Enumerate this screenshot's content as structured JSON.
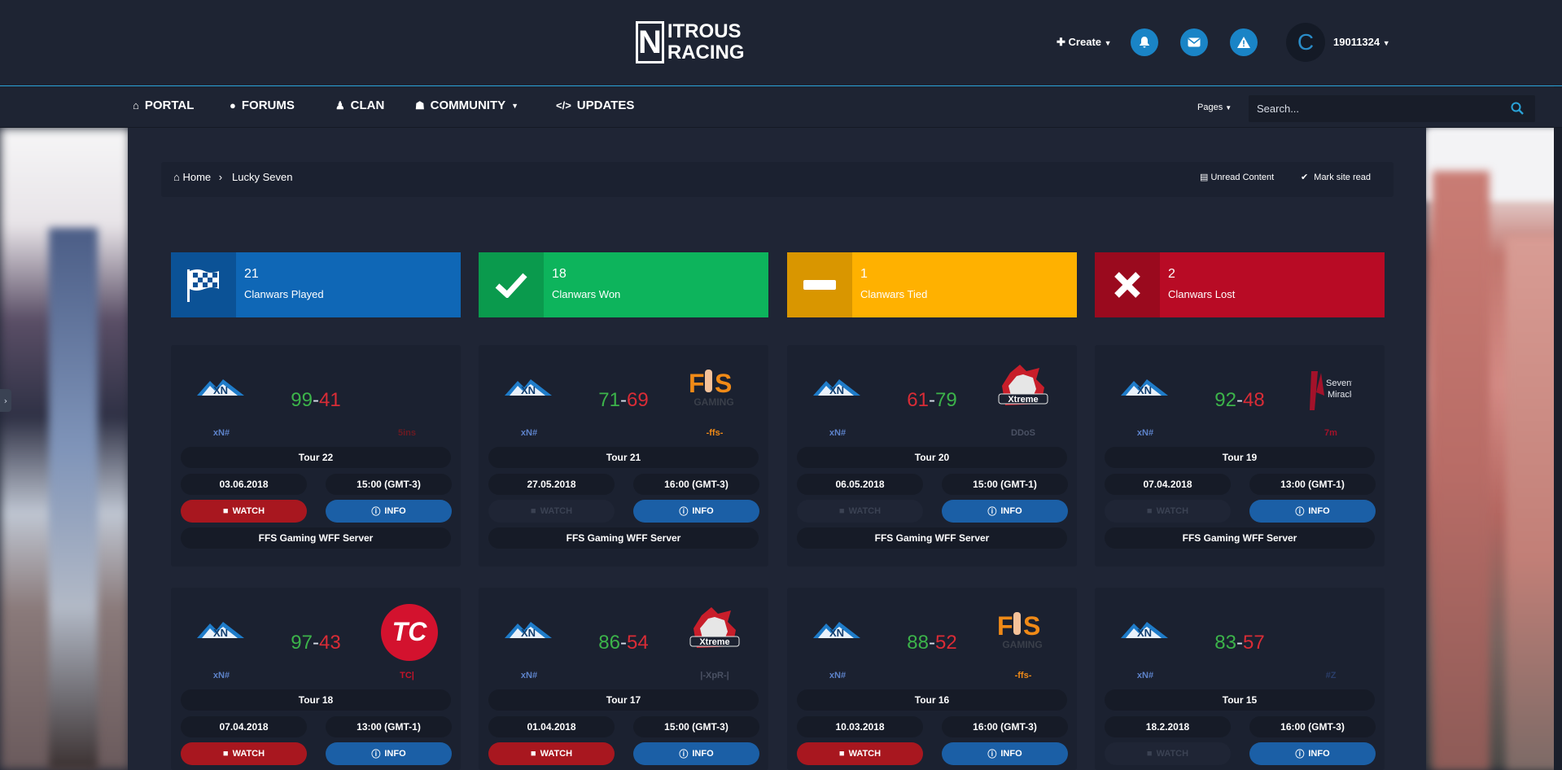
{
  "header": {
    "logo_line1": "ITROUS",
    "logo_line2": "RACING",
    "logo_mark": "N",
    "create_label": "Create",
    "username": "19011324",
    "avatar_letter": "C"
  },
  "nav": {
    "items": [
      {
        "label": "PORTAL",
        "icon": "home-icon"
      },
      {
        "label": "FORUMS",
        "icon": "comment-icon"
      },
      {
        "label": "CLAN",
        "icon": "user-icon"
      },
      {
        "label": "COMMUNITY",
        "icon": "users-icon"
      },
      {
        "label": "UPDATES",
        "icon": "code-icon"
      }
    ],
    "pages_label": "Pages",
    "search_placeholder": "Search..."
  },
  "breadcrumb": {
    "home": "Home",
    "current": "Lucky Seven",
    "unread": "Unread Content",
    "mark_read": "Mark site read"
  },
  "stats": [
    {
      "value": "21",
      "label": "Clanwars Played",
      "color": "#0f67b6",
      "icon_color": "#0b5296"
    },
    {
      "value": "18",
      "label": "Clanwars Won",
      "color": "#0db45c",
      "icon_color": "#0a9a4d"
    },
    {
      "value": "1",
      "label": "Clanwars Tied",
      "color": "#ffb100",
      "icon_color": "#d99600"
    },
    {
      "value": "2",
      "label": "Clanwars Lost",
      "color": "#b80b25",
      "icon_color": "#9a0a1e"
    }
  ],
  "matches": [
    {
      "home_tag": "xN#",
      "away_tag": "5ins",
      "home_score": "99",
      "away_score": "41",
      "tour": "Tour 22",
      "date": "03.06.2018",
      "time": "15:00 (GMT-3)",
      "watch": "WATCH",
      "info": "INFO",
      "server": "FFS Gaming WFF Server",
      "watch_on": true,
      "away_color": "#6b1a22"
    },
    {
      "home_tag": "xN#",
      "away_tag": "-ffs-",
      "home_score": "71",
      "away_score": "69",
      "tour": "Tour 21",
      "date": "27.05.2018",
      "time": "16:00 (GMT-3)",
      "watch": "WATCH",
      "info": "INFO",
      "server": "FFS Gaming WFF Server",
      "watch_on": false,
      "away_color": "#f08a17"
    },
    {
      "home_tag": "xN#",
      "away_tag": "DDoS",
      "home_score": "61",
      "away_score": "79",
      "tour": "Tour 20",
      "date": "06.05.2018",
      "time": "15:00 (GMT-1)",
      "watch": "WATCH",
      "info": "INFO",
      "server": "FFS Gaming WFF Server",
      "watch_on": false,
      "away_color": "#4a5163"
    },
    {
      "home_tag": "xN#",
      "away_tag": "7m",
      "home_score": "92",
      "away_score": "48",
      "tour": "Tour 19",
      "date": "07.04.2018",
      "time": "13:00 (GMT-1)",
      "watch": "WATCH",
      "info": "INFO",
      "server": "FFS Gaming WFF Server",
      "watch_on": false,
      "away_color": "#a3122a"
    },
    {
      "home_tag": "xN#",
      "away_tag": "TC|",
      "home_score": "97",
      "away_score": "43",
      "tour": "Tour 18",
      "date": "07.04.2018",
      "time": "13:00 (GMT-1)",
      "watch": "WATCH",
      "info": "INFO",
      "watch_on": true,
      "away_color": "#c4142a"
    },
    {
      "home_tag": "xN#",
      "away_tag": "|-XpR-|",
      "home_score": "86",
      "away_score": "54",
      "tour": "Tour 17",
      "date": "01.04.2018",
      "time": "15:00 (GMT-3)",
      "watch": "WATCH",
      "info": "INFO",
      "watch_on": true,
      "away_color": "#4a5163"
    },
    {
      "home_tag": "xN#",
      "away_tag": "-ffs-",
      "home_score": "88",
      "away_score": "52",
      "tour": "Tour 16",
      "date": "10.03.2018",
      "time": "16:00 (GMT-3)",
      "watch": "WATCH",
      "info": "INFO",
      "watch_on": true,
      "away_color": "#f08a17"
    },
    {
      "home_tag": "xN#",
      "away_tag": "#Z",
      "home_score": "83",
      "away_score": "57",
      "tour": "Tour 15",
      "date": "18.2.2018",
      "time": "16:00 (GMT-3)",
      "watch": "WATCH",
      "info": "INFO",
      "watch_on": false,
      "away_color": "#2b3e6a"
    }
  ],
  "opponents": {
    "ffs_text": "FS",
    "ffs_sub": "GAMING",
    "xtreme_text": "Xtreme",
    "seventh_line1": "Seventh",
    "seventh_line2": "Miracle",
    "tc_text": "TC",
    "xn_text": "XN"
  },
  "side_toggle": "›"
}
